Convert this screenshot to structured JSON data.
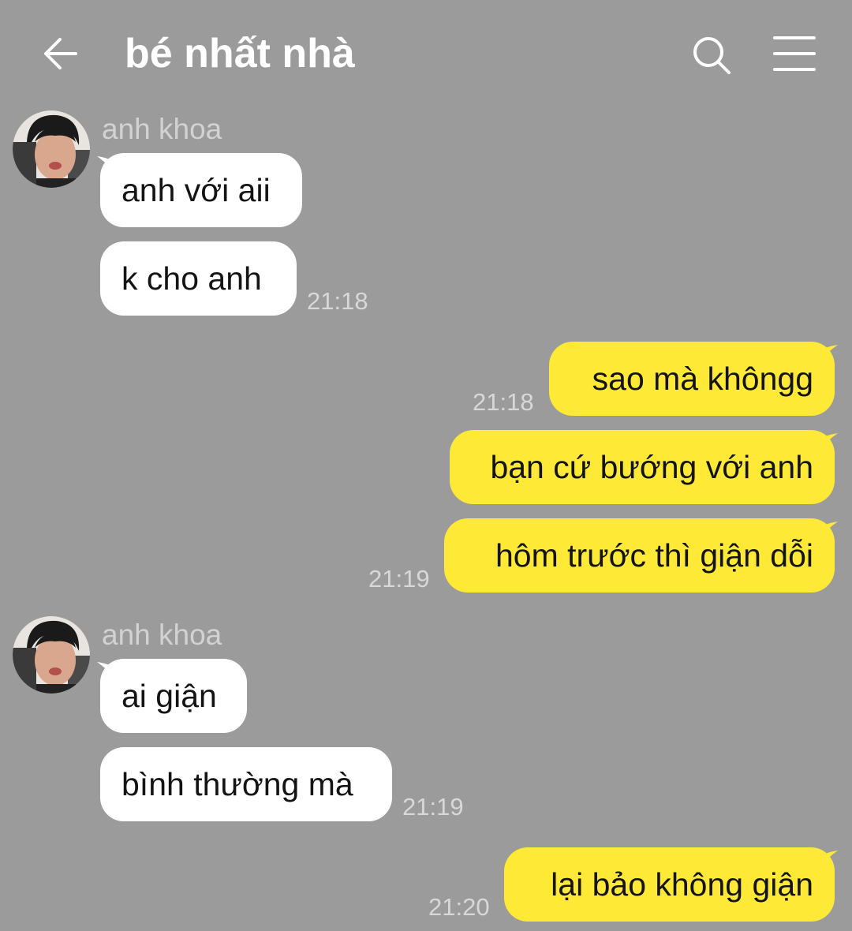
{
  "header": {
    "title": "bé nhất nhà",
    "back_icon": "arrow-left-icon",
    "search_icon": "search-icon",
    "menu_icon": "hamburger-menu-icon"
  },
  "colors": {
    "background": "#9b9b9b",
    "incoming_bubble": "#ffffff",
    "outgoing_bubble": "#fde936",
    "timestamp": "#d8d8d8",
    "sender_name": "#d2d2d2"
  },
  "messages": [
    {
      "sender": "anh khoa",
      "text": "anh với aii"
    },
    {
      "text": "k cho anh",
      "time": "21:18"
    },
    {
      "text": "sao mà khôngg",
      "time": "21:18"
    },
    {
      "text": "bạn cứ bướng với anh"
    },
    {
      "text": "hôm trước thì giận dỗi",
      "time": "21:19"
    },
    {
      "sender": "anh khoa",
      "text": "ai giận"
    },
    {
      "text": "bình thường mà",
      "time": "21:19"
    },
    {
      "text": "lại bảo không giận",
      "time": "21:20"
    }
  ]
}
